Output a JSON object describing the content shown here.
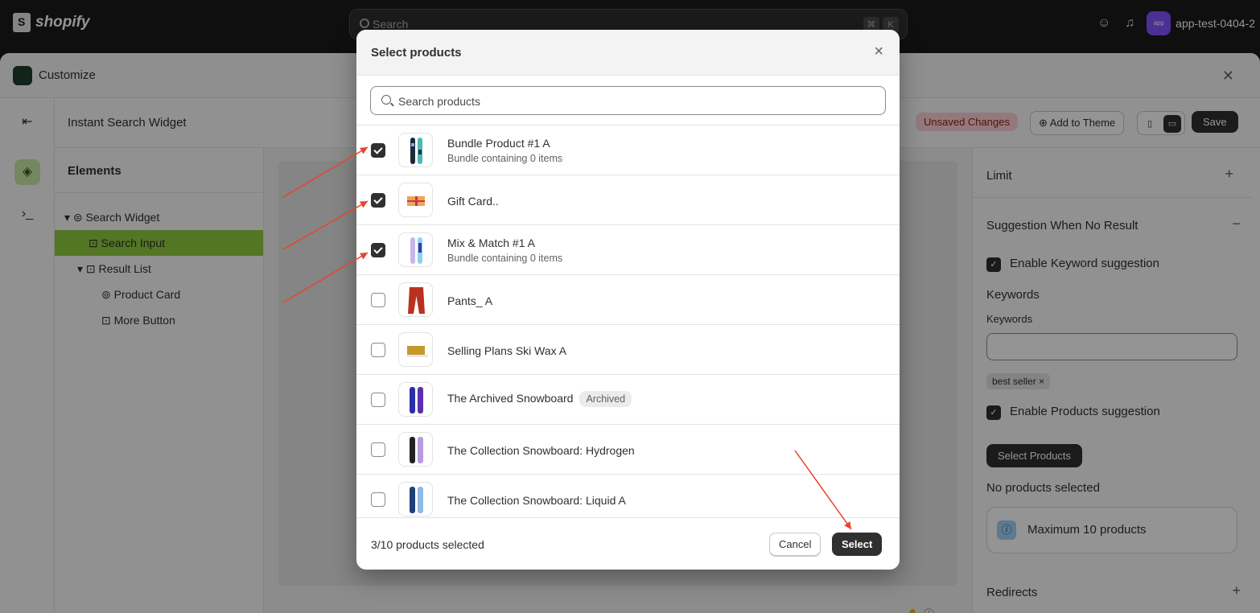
{
  "topbar": {
    "brand": "shopify",
    "search_placeholder": "Search",
    "kbd_cmd": "⌘",
    "kbd_k": "K",
    "app_avatar": "app",
    "app_name": "app-test-0404-2"
  },
  "window": {
    "title": "Customize",
    "close": "✕"
  },
  "subheader": {
    "title": "Instant Search Widget",
    "unsaved": "Unsaved Changes",
    "add_to_theme": "⊕ Add to Theme",
    "save": "Save"
  },
  "tree": {
    "heading": "Elements",
    "items": [
      {
        "label": "▾ ⊜ Search Widget"
      },
      {
        "label": "⊡ Search Input"
      },
      {
        "label": "▾ ⊡ Result List"
      },
      {
        "label": "⊚ Product Card"
      },
      {
        "label": "⊡ More Button"
      }
    ]
  },
  "right_panel": {
    "limit": "Limit",
    "plus": "+",
    "minus": "−",
    "suggestion_heading": "Suggestion When No Result",
    "enable_keyword": "Enable Keyword suggestion",
    "keywords_label": "Keywords",
    "keywords_sublabel": "Keywords",
    "tag": "best seller ×",
    "enable_products": "Enable Products suggestion",
    "select_products": "Select Products",
    "no_products": "No products selected",
    "max_products": "Maximum 10 products",
    "redirects": "Redirects"
  },
  "modal": {
    "title": "Select products",
    "close": "×",
    "search_placeholder": "Search products",
    "products": [
      {
        "title": "Bundle Product #1 A",
        "subtitle": "Bundle containing 0 items",
        "checked": true
      },
      {
        "title": "Gift Card..",
        "subtitle": "",
        "checked": true
      },
      {
        "title": "Mix & Match #1 A",
        "subtitle": "Bundle containing 0 items",
        "checked": true
      },
      {
        "title": "Pants_ A",
        "subtitle": "",
        "checked": false
      },
      {
        "title": "Selling Plans Ski Wax A",
        "subtitle": "",
        "checked": false
      },
      {
        "title": "The Archived Snowboard",
        "subtitle": "",
        "badge": "Archived",
        "checked": false
      },
      {
        "title": "The Collection Snowboard: Hydrogen",
        "subtitle": "",
        "checked": false
      },
      {
        "title": "The Collection Snowboard: Liquid A",
        "subtitle": "",
        "checked": false
      }
    ],
    "selected_count": "3/10 products selected",
    "cancel": "Cancel",
    "select": "Select"
  },
  "colors": {
    "annotation_arrow": "#e8442a",
    "selected_tree_row": "#8fcc3f",
    "primary_button": "#303030"
  }
}
